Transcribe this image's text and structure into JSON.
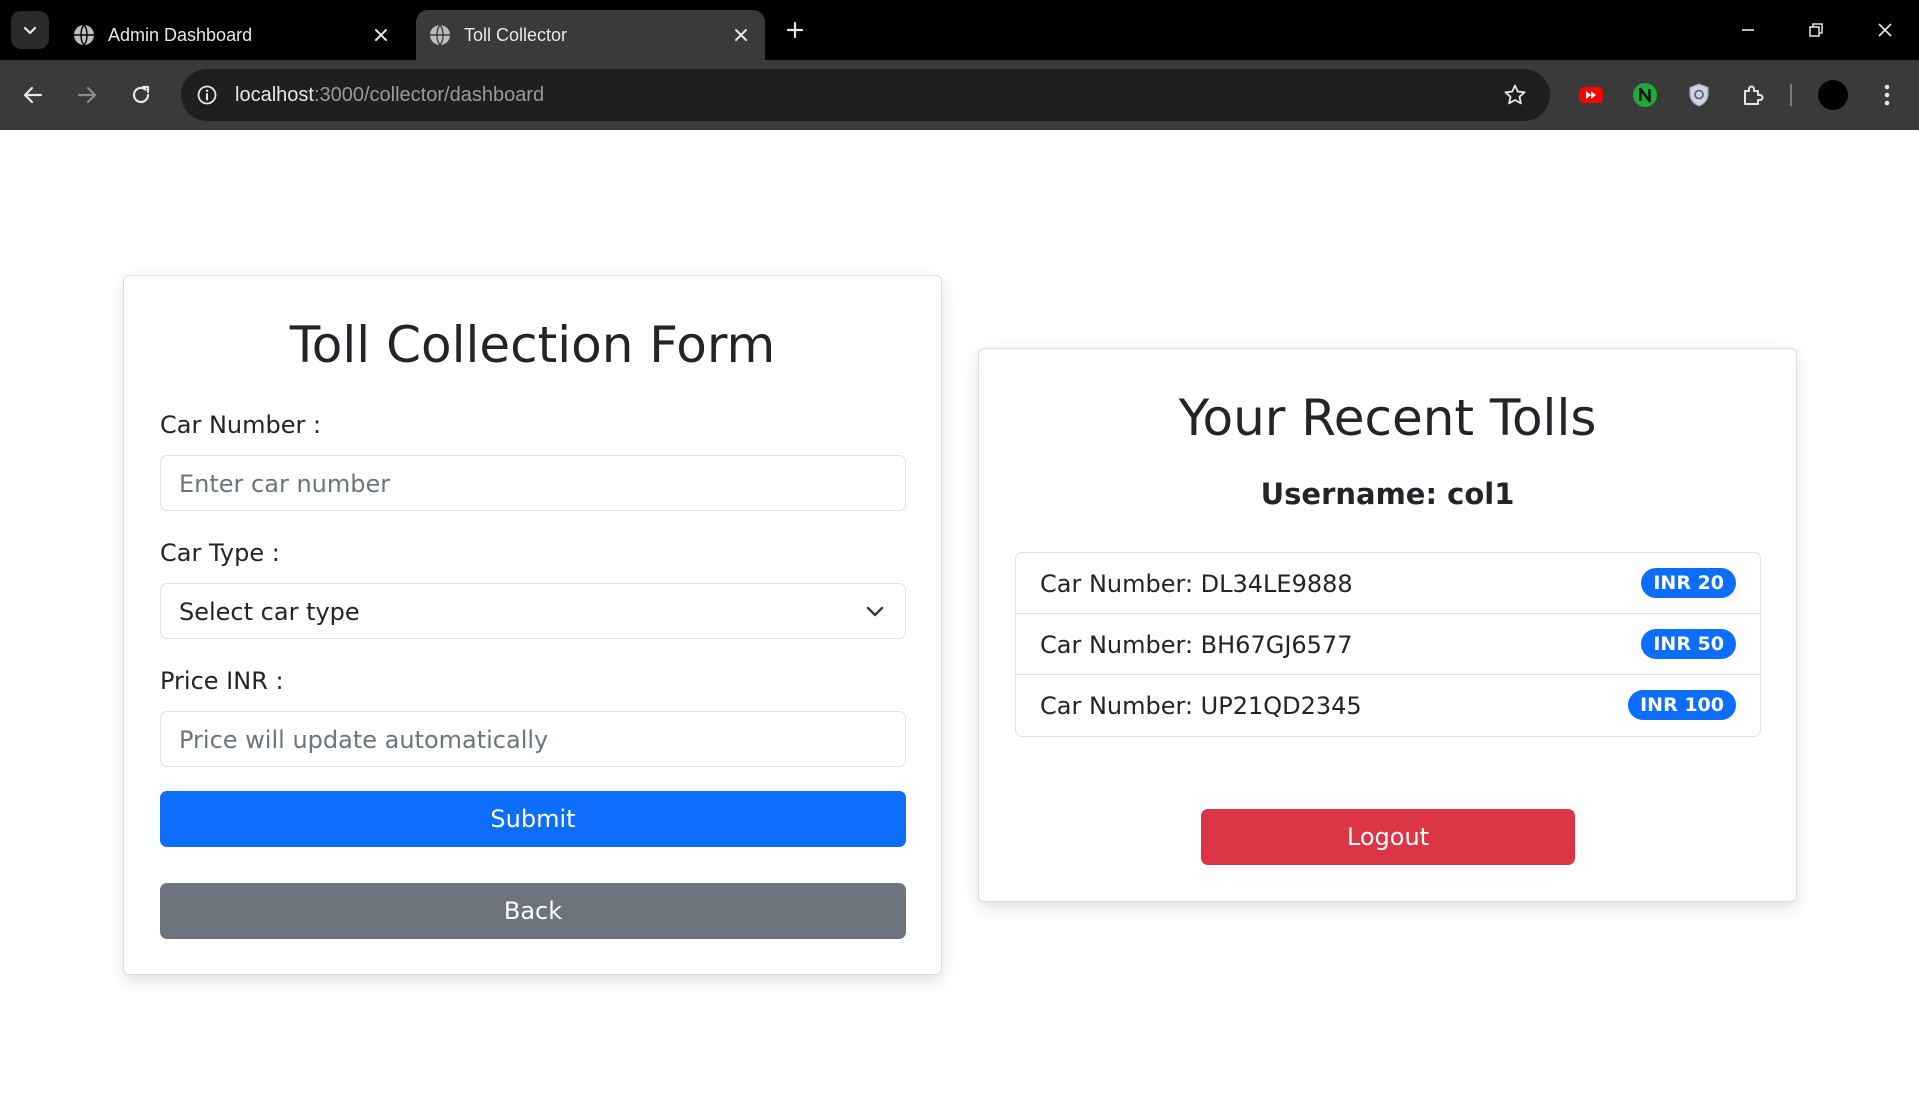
{
  "browser": {
    "tabs": [
      {
        "title": "Admin Dashboard",
        "active": false
      },
      {
        "title": "Toll Collector",
        "active": true
      }
    ],
    "url_host": "localhost",
    "url_path": ":3000/collector/dashboard"
  },
  "form": {
    "title": "Toll Collection Form",
    "car_number_label": "Car Number :",
    "car_number_placeholder": "Enter car number",
    "car_type_label": "Car Type :",
    "car_type_selected": "Select car type",
    "price_label": "Price INR :",
    "price_placeholder": "Price will update automatically",
    "submit_label": "Submit",
    "back_label": "Back"
  },
  "tolls": {
    "title": "Your Recent Tolls",
    "username_text": "Username: col1",
    "items": [
      {
        "car": "Car Number: DL34LE9888",
        "amount": "INR 20"
      },
      {
        "car": "Car Number: BH67GJ6577",
        "amount": "INR 50"
      },
      {
        "car": "Car Number: UP21QD2345",
        "amount": "INR 100"
      }
    ],
    "logout_label": "Logout"
  },
  "colors": {
    "primary": "#0d6efd",
    "secondary": "#6c757d",
    "danger": "#dc3545"
  }
}
